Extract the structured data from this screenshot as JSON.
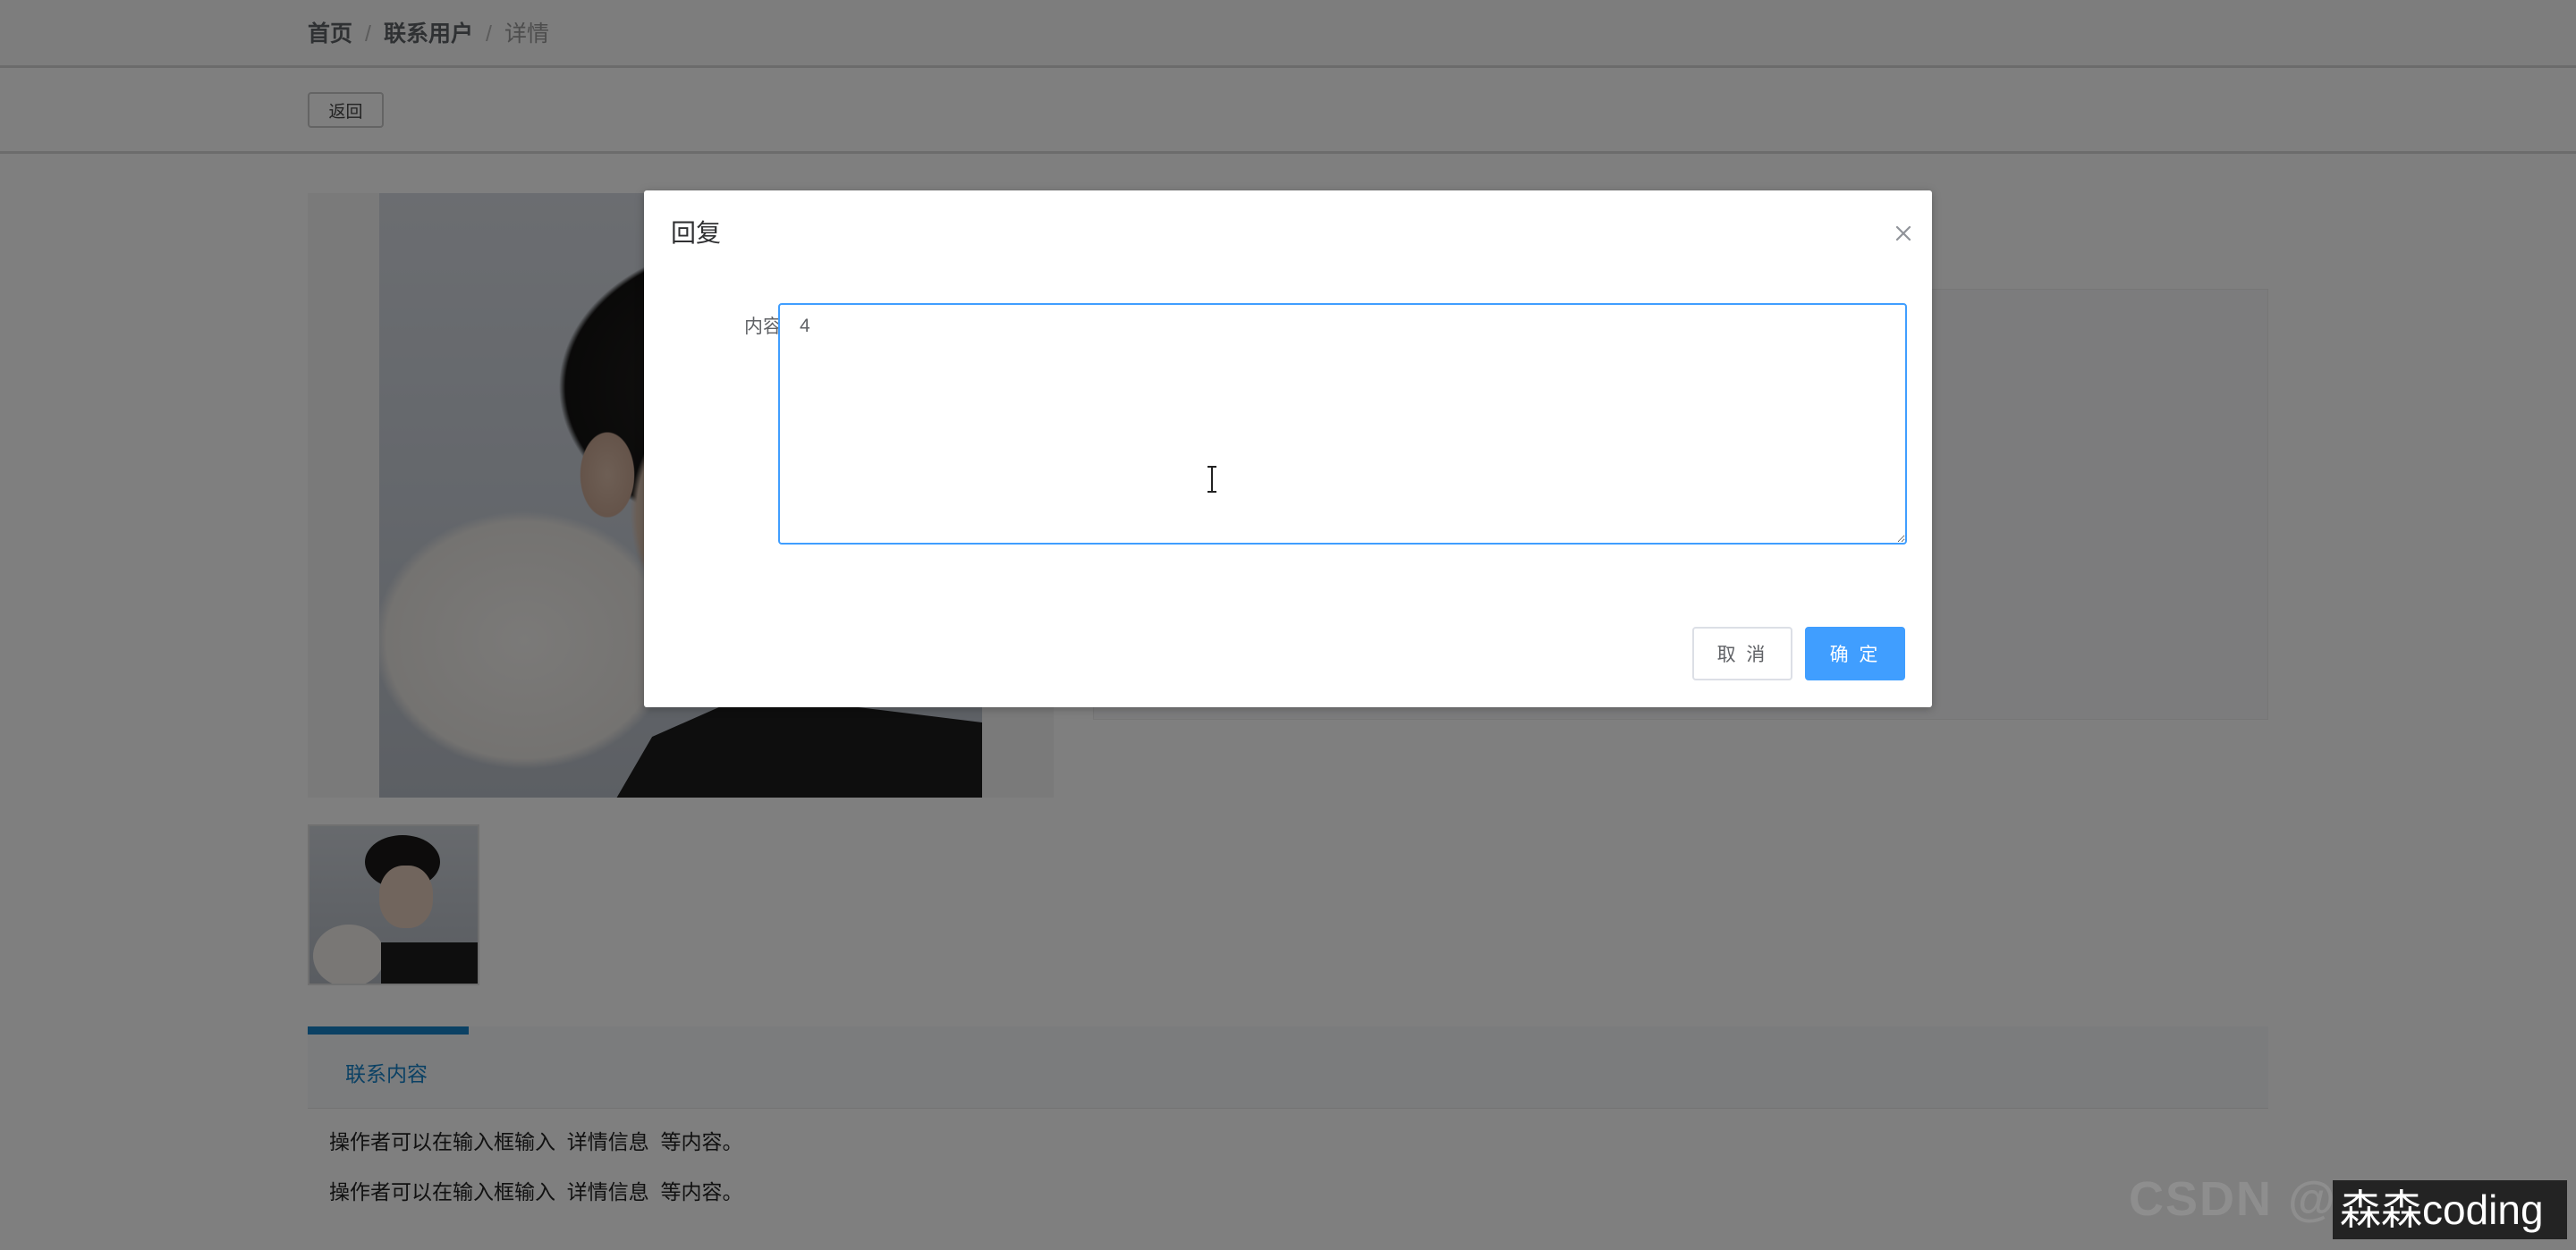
{
  "breadcrumb": {
    "items": [
      "首页",
      "联系用户",
      "详情"
    ],
    "separator": "/"
  },
  "toolbar": {
    "back_label": "返回"
  },
  "tabs": {
    "active_label": "联系内容",
    "active_color": "#1683c9"
  },
  "details": {
    "lines": [
      "操作者可以在输入框输入  详情信息  等内容。",
      "操作者可以在输入框输入  详情信息  等内容。"
    ]
  },
  "dialog": {
    "title": "回复",
    "field_label": "内容",
    "content_value": "4",
    "cancel_label": "取 消",
    "confirm_label": "确 定",
    "primary_color": "#409eff",
    "close_icon": "close-icon"
  },
  "watermark": {
    "channel": "森森coding",
    "faint_text": "CSDN @"
  }
}
